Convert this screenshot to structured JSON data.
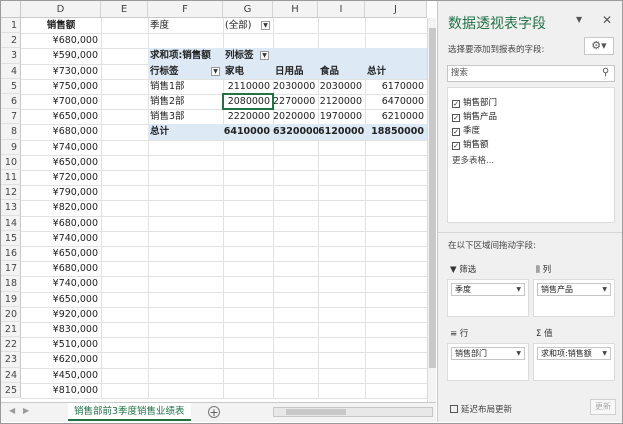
{
  "columns": [
    "D",
    "E",
    "F",
    "G",
    "H",
    "I",
    "J"
  ],
  "rows": [
    "1",
    "2",
    "3",
    "4",
    "5",
    "6",
    "7",
    "8",
    "9",
    "10",
    "11",
    "12",
    "13",
    "14",
    "15",
    "16",
    "17",
    "18",
    "19",
    "20",
    "21",
    "22",
    "23",
    "24",
    "25"
  ],
  "sales_column": {
    "header": "销售额",
    "values": [
      "¥680,000",
      "¥590,000",
      "¥730,000",
      "¥750,000",
      "¥700,000",
      "¥650,000",
      "¥680,000",
      "¥740,000",
      "¥650,000",
      "¥720,000",
      "¥790,000",
      "¥820,000",
      "¥680,000",
      "¥740,000",
      "¥650,000",
      "¥680,000",
      "¥740,000",
      "¥650,000",
      "¥920,000",
      "¥830,000",
      "¥510,000",
      "¥620,000",
      "¥450,000",
      "¥810,000"
    ]
  },
  "pivot": {
    "filter_label": "季度",
    "filter_value": "(全部)",
    "values_label": "求和项:销售额",
    "col_labels_label": "列标签",
    "row_labels_label": "行标签",
    "col_headers": [
      "家电",
      "日用品",
      "食品",
      "总计"
    ],
    "rows": [
      {
        "label": "销售1部",
        "values": [
          "2110000",
          "2030000",
          "2030000",
          "6170000"
        ]
      },
      {
        "label": "销售2部",
        "values": [
          "2080000",
          "2270000",
          "2120000",
          "6470000"
        ]
      },
      {
        "label": "销售3部",
        "values": [
          "2220000",
          "2020000",
          "1970000",
          "6210000"
        ]
      }
    ],
    "total": {
      "label": "总计",
      "values": [
        "6410000",
        "6320000",
        "6120000",
        "18850000"
      ]
    },
    "selected_cell": "G6"
  },
  "tabs": {
    "active": "销售部前3季度销售业绩表",
    "add_symbol": "⊕"
  },
  "panel": {
    "title": "数据透视表字段",
    "instruction": "选择要添加到报表的字段:",
    "search_placeholder": "搜索",
    "fields": [
      {
        "label": "销售部门",
        "checked": true
      },
      {
        "label": "销售产品",
        "checked": true
      },
      {
        "label": "季度",
        "checked": true
      },
      {
        "label": "销售额",
        "checked": true
      }
    ],
    "more_tables": "更多表格...",
    "drag_text": "在以下区域间拖动字段:",
    "areas": {
      "filter": {
        "label": "筛选",
        "field": "季度"
      },
      "columns": {
        "label": "列",
        "field": "销售产品"
      },
      "rows": {
        "label": "行",
        "field": "销售部门"
      },
      "values": {
        "label": "值",
        "field": "求和项:销售额"
      }
    },
    "defer_label": "延迟布局更新",
    "update_label": "更新"
  }
}
